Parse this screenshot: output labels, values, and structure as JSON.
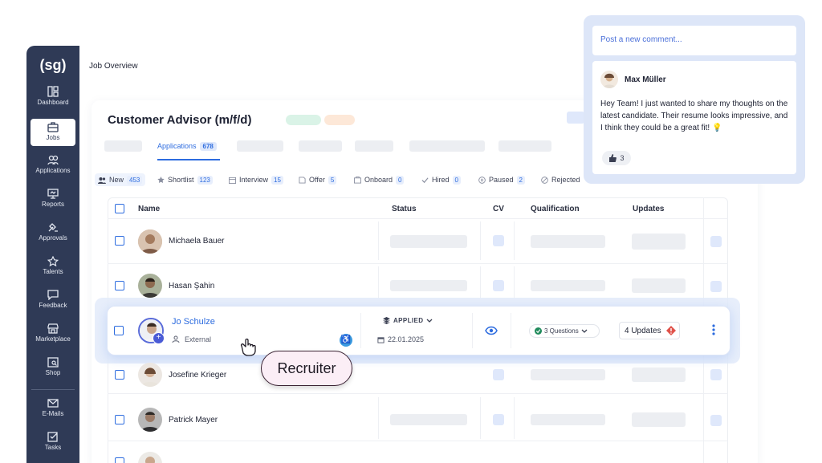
{
  "sidebar": {
    "logo": "(sg)",
    "items": [
      {
        "label": "Dashboard",
        "icon": "dashboard-icon"
      },
      {
        "label": "Jobs",
        "icon": "briefcase-icon",
        "active": true
      },
      {
        "label": "Applications",
        "icon": "users-icon"
      },
      {
        "label": "Reports",
        "icon": "reports-icon"
      },
      {
        "label": "Approvals",
        "icon": "approvals-icon"
      },
      {
        "label": "Talents",
        "icon": "star-icon"
      },
      {
        "label": "Feedback",
        "icon": "feedback-icon"
      },
      {
        "label": "Marketplace",
        "icon": "store-icon"
      },
      {
        "label": "Shop",
        "icon": "shop-icon"
      },
      {
        "label": "E-Mails",
        "icon": "mail-icon"
      },
      {
        "label": "Tasks",
        "icon": "tasks-icon"
      }
    ]
  },
  "header": {
    "title": "Job Overview"
  },
  "job": {
    "title": "Customer Advisor (m/f/d)"
  },
  "tabs": {
    "applications_label": "Applications",
    "applications_count": "678"
  },
  "filters": [
    {
      "label": "New",
      "count": "453",
      "icon": "users-icon"
    },
    {
      "label": "Shortlist",
      "count": "123",
      "icon": "star-icon"
    },
    {
      "label": "Interview",
      "count": "15",
      "icon": "calendar-icon"
    },
    {
      "label": "Offer",
      "count": "5",
      "icon": "offer-icon"
    },
    {
      "label": "Onboard",
      "count": "0",
      "icon": "onboard-icon"
    },
    {
      "label": "Hired",
      "count": "0",
      "icon": "check-icon"
    },
    {
      "label": "Paused",
      "count": "2",
      "icon": "pause-icon"
    },
    {
      "label": "Rejected",
      "count": "",
      "icon": "reject-icon"
    }
  ],
  "table": {
    "headers": {
      "name": "Name",
      "status": "Status",
      "cv": "CV",
      "qualification": "Qualification",
      "updates": "Updates"
    },
    "rows": [
      {
        "name": "Michaela Bauer"
      },
      {
        "name": "Hasan Şahin"
      },
      {
        "name": "Jo Schulze",
        "source": "External",
        "status": "APPLIED",
        "date": "22.01.2025",
        "questions": "3 Questions",
        "updates": "4 Updates"
      },
      {
        "name": "Josefine Krieger"
      },
      {
        "name": "Patrick Mayer"
      }
    ]
  },
  "tooltip": {
    "label": "Recruiter"
  },
  "comments": {
    "placeholder": "Post a new comment...",
    "author": "Max Müller",
    "text": "Hey Team! I just wanted to share my thoughts on the latest candidate. Their resume looks impressive, and I think they could be a great fit! 💡",
    "likes": "3"
  },
  "colors": {
    "accent": "#2d6cdf",
    "sidebar": "#2f3a56",
    "alert": "#e0524a"
  }
}
